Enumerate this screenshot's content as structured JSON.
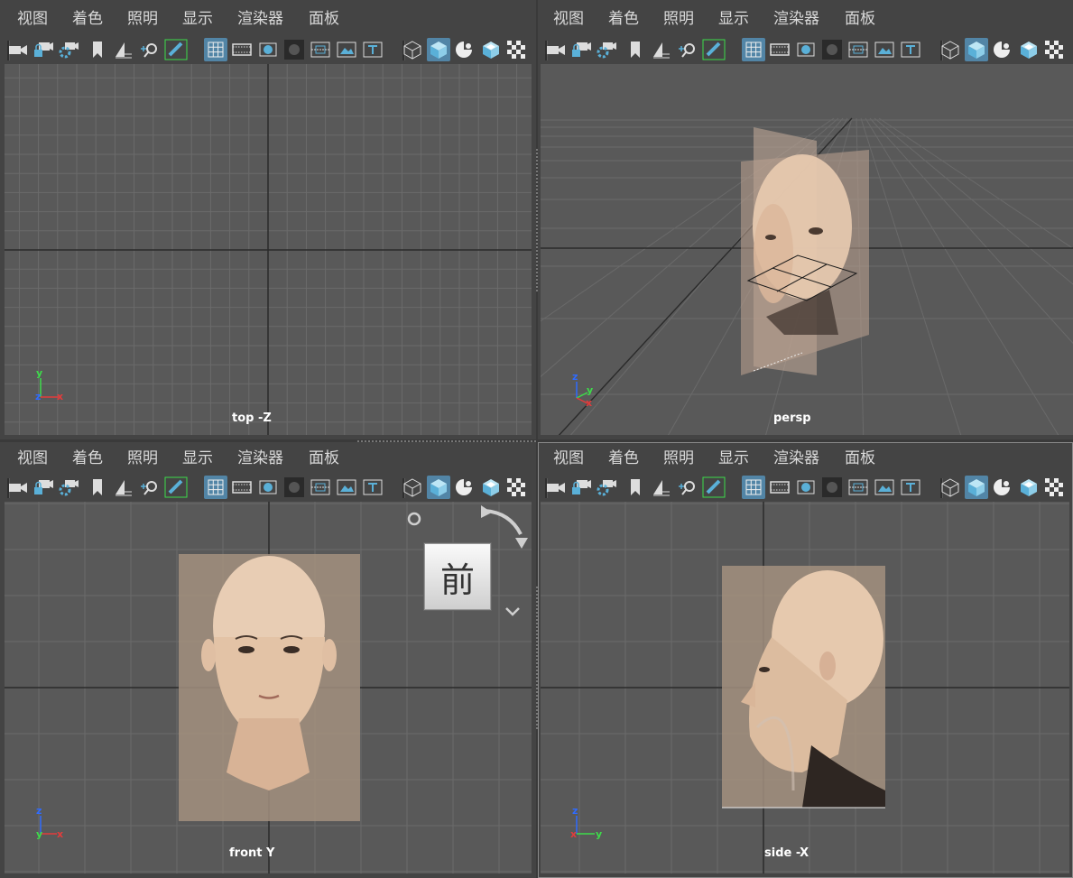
{
  "menu": [
    "视图",
    "着色",
    "照明",
    "显示",
    "渲染器",
    "面板"
  ],
  "panels": {
    "top": {
      "camera_label": "top -Z"
    },
    "persp": {
      "camera_label": "persp"
    },
    "front": {
      "camera_label": "front Y"
    },
    "side": {
      "camera_label": "side -X"
    }
  },
  "axes": {
    "x": "x",
    "y": "y",
    "z": "z"
  },
  "viewcube": {
    "face_label": "前"
  },
  "colors": {
    "accent": "#5285a6",
    "x_axis": "#e23c3c",
    "y_axis": "#3ddc4a",
    "z_axis": "#2f6bff",
    "viewport": "#595959",
    "grid": "#6b6b6b"
  },
  "toolbar_icons": [
    "camera-select-icon",
    "camera-lock-icon",
    "camera-attributes-icon",
    "bookmark-icon",
    "image-plane-icon",
    "2d-pan-zoom-icon",
    "grease-pencil-icon",
    "grid-icon",
    "film-gate-icon",
    "resolution-gate-icon",
    "gate-mask-icon",
    "field-chart-icon",
    "safe-action-icon",
    "safe-title-icon",
    "wireframe-icon",
    "smooth-shade-icon",
    "default-material-icon",
    "xray-icon",
    "checker-texture-icon"
  ]
}
